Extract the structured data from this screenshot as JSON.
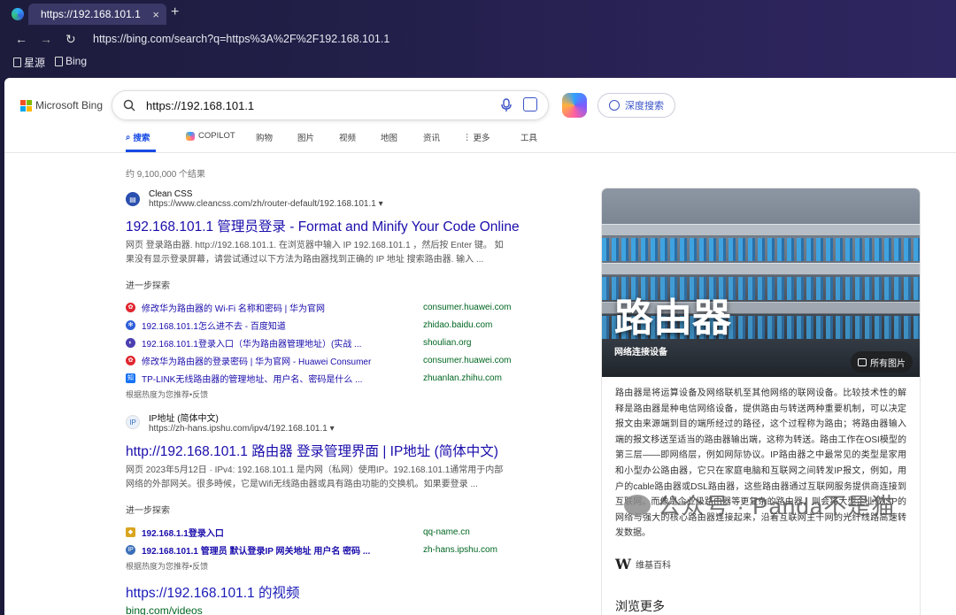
{
  "browser": {
    "tab_title": "https://192.168.101.1",
    "tab_close": "×",
    "new_tab": "+",
    "back": "←",
    "forward": "→",
    "reload": "↻",
    "address": "https://bing.com/search?q=https%3A%2F%2F192.168.101.1",
    "bookmarks": [
      "星源",
      "Bing"
    ]
  },
  "bing": {
    "logo_text": "Microsoft Bing",
    "query": "https://192.168.101.1",
    "deep_search": "深度搜索",
    "tabs": [
      "搜索",
      "COPILOT",
      "购物",
      "图片",
      "视频",
      "地图",
      "资讯",
      "更多",
      "工具"
    ],
    "result_count": "约 9,100,000 个结果"
  },
  "results": [
    {
      "site_name": "Clean CSS",
      "site_url": "https://www.cleancss.com/zh/router-default/192.168.101.1",
      "title": "192.168.101.1 管理员登录 - Format and Minify Your Code Online",
      "snippet_line1": "网页 登录路由器. http://192.168.101.1. 在浏览器中输入 IP 192.168.101.1 ，然后按 Enter 键。 如",
      "snippet_line2": "果没有显示登录屏幕，请尝试通过以下方法为路由器找到正确的 IP 地址 搜索路由器. 输入 ...",
      "more_label": "进一步探索",
      "related": [
        {
          "label": "修改华为路由器的 Wi-Fi 名称和密码 | 华为官网",
          "domain": "consumer.huawei.com"
        },
        {
          "label": "192.168.101.1怎么进不去 - 百度知道",
          "domain": "zhidao.baidu.com"
        },
        {
          "label": "192.168.101.1登录入口（华为路由器管理地址）(实战 ...",
          "domain": "shoulian.org"
        },
        {
          "label": "修改华为路由器的登录密码 | 华为官网 - Huawei Consumer",
          "domain": "consumer.huawei.com"
        },
        {
          "label": "TP-LINK无线路由器的管理地址、用户名、密码是什么 ...",
          "domain": "zhuanlan.zhihu.com"
        }
      ],
      "feedback": "根据热度为您推荐•反馈"
    },
    {
      "site_name": "IP地址 (简体中文)",
      "site_url": "https://zh-hans.ipshu.com/ipv4/192.168.101.1",
      "title": "http://192.168.101.1 路由器 登录管理界面 | IP地址 (简体中文)",
      "snippet_line1": "网页 2023年5月12日 · IPv4: 192.168.101.1 是内网（私网）使用IP。192.168.101.1通常用于内部",
      "snippet_line2": "网络的外部网关。很多時候，它是Wifi无线路由器或具有路由功能的交换机。如果要登录 ...",
      "more_label": "进一步探索",
      "related": [
        {
          "label": "192.168.1.1登录入口",
          "domain": "qq-name.cn"
        },
        {
          "label": "192.168.101.1 管理员 默认登录IP 网关地址 用户名 密码 ...",
          "domain": "zh-hans.ipshu.com"
        }
      ],
      "feedback": "根据热度为您推荐•反馈"
    },
    {
      "title": "https://192.168.101.1 的视频",
      "site_url": "bing.com/videos"
    }
  ],
  "panel": {
    "title": "路由器",
    "subtitle": "网络连接设备",
    "all_images": "所有图片",
    "description": "路由器是将运算设备及网络联机至其他网络的联网设备。比较技术性的解释是路由器是种电信网络设备，提供路由与转送两种重要机制，可以决定报文由来源端到目的端所经过的路径，这个过程称为路由；将路由器输入端的报文移送至适当的路由器输出端，这称为转送。路由工作在OSI模型的第三层——即网络层，例如网际协议。IP路由器之中最常见的类型是家用和小型办公路由器，它只在家庭电脑和互联网之间转发IP报文，例如，用户的cable路由器或DSL路由器，这些路由器通过互联网服务提供商连接到互联网。而像是企业级路由器等更复杂的路由器，则会将大型企业或ISP的网络与强大的核心路由器连接起来，沿着互联网主干网的光纤线路高速转发数据。",
    "wiki_label": "维基百科",
    "browse_more": "浏览更多"
  },
  "watermark": "公众号 · Panda不是猫",
  "colors": {
    "link": "#1a0dab",
    "accent": "#174ae4",
    "domain": "#006621"
  }
}
